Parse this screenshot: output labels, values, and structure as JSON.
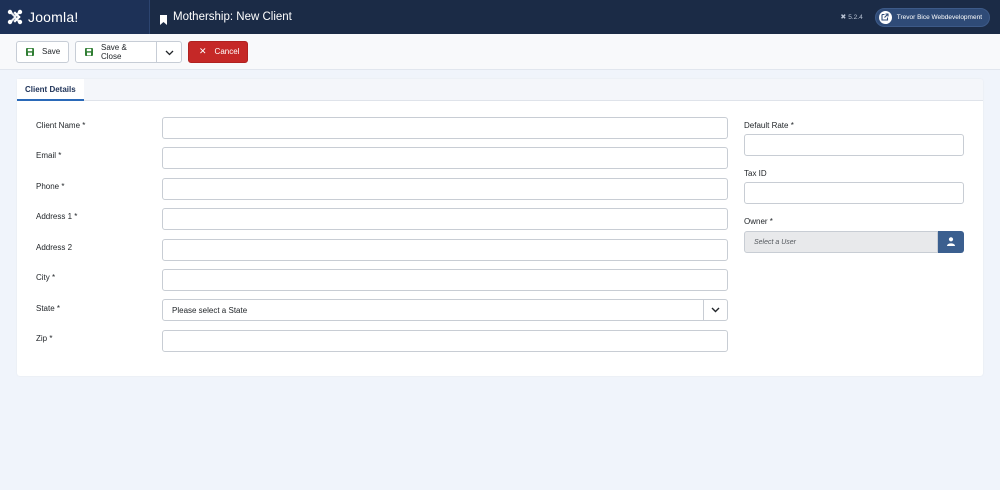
{
  "header": {
    "logo_text": "Joomla!",
    "page_title": "Mothership: New Client",
    "version": "5.2.4",
    "site_button": "Trevor Bice Webdevelopment"
  },
  "toolbar": {
    "save_label": "Save",
    "save_close_label": "Save & Close",
    "cancel_label": "Cancel"
  },
  "tabs": [
    {
      "label": "Client Details",
      "active": true
    }
  ],
  "form": {
    "client_name_label": "Client Name *",
    "email_label": "Email *",
    "phone_label": "Phone *",
    "address1_label": "Address 1 *",
    "address2_label": "Address 2",
    "city_label": "City *",
    "state_label": "State *",
    "state_value": "Please select a State",
    "zip_label": "Zip *",
    "default_rate_label": "Default Rate *",
    "tax_id_label": "Tax ID",
    "owner_label": "Owner *",
    "owner_placeholder": "Select a User"
  },
  "colors": {
    "header_bg": "#1b2b46",
    "accent": "#2a69b8",
    "cancel": "#c52827",
    "user_button": "#3b5f8f",
    "save_icon": "#2f7d32"
  }
}
